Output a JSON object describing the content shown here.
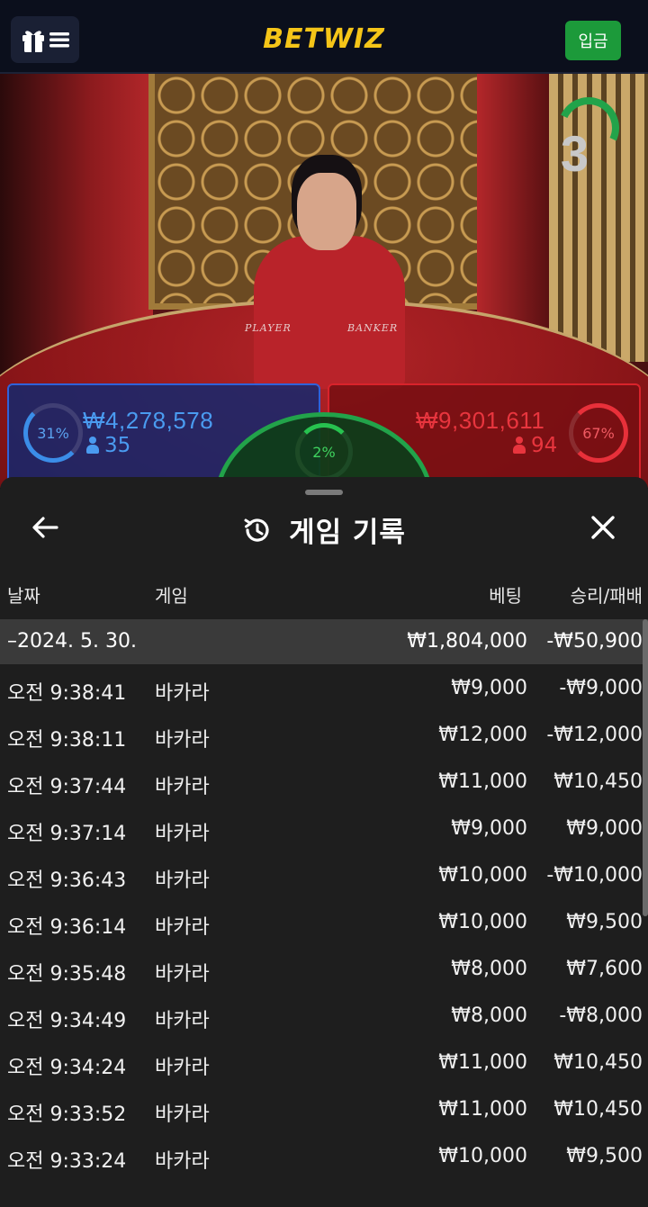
{
  "header": {
    "logo": "BETWIZ",
    "deposit_label": "입금",
    "menu_icon": "gift-menu-icon"
  },
  "live": {
    "countdown": "3",
    "table_labels": {
      "player": "PLAYER",
      "banker": "BANKER"
    },
    "player": {
      "percent": "31%",
      "amount": "₩4,278,578",
      "count": "35"
    },
    "banker": {
      "percent": "67%",
      "amount": "₩9,301,611",
      "count": "94"
    },
    "tie": {
      "percent": "2%"
    },
    "colors": {
      "player": "#2f62d9",
      "banker": "#d9232b",
      "tie": "#22a34a",
      "logo": "#f5c518"
    }
  },
  "history": {
    "title": "게임 기록",
    "title_icon": "history-clock-icon",
    "back_icon": "back-arrow-icon",
    "close_icon": "close-icon",
    "columns": {
      "date": "날짜",
      "game": "게임",
      "bet": "베팅",
      "result": "승리/패배"
    },
    "summary": {
      "date": "–2024. 5. 30.",
      "bet": "₩1,804,000",
      "result": "-₩50,900"
    },
    "rows": [
      {
        "time": "오전 9:38:41",
        "game": "바카라",
        "bet": "₩9,000",
        "result": "-₩9,000"
      },
      {
        "time": "오전 9:38:11",
        "game": "바카라",
        "bet": "₩12,000",
        "result": "-₩12,000"
      },
      {
        "time": "오전 9:37:44",
        "game": "바카라",
        "bet": "₩11,000",
        "result": "₩10,450"
      },
      {
        "time": "오전 9:37:14",
        "game": "바카라",
        "bet": "₩9,000",
        "result": "₩9,000"
      },
      {
        "time": "오전 9:36:43",
        "game": "바카라",
        "bet": "₩10,000",
        "result": "-₩10,000"
      },
      {
        "time": "오전 9:36:14",
        "game": "바카라",
        "bet": "₩10,000",
        "result": "₩9,500"
      },
      {
        "time": "오전 9:35:48",
        "game": "바카라",
        "bet": "₩8,000",
        "result": "₩7,600"
      },
      {
        "time": "오전 9:34:49",
        "game": "바카라",
        "bet": "₩8,000",
        "result": "-₩8,000"
      },
      {
        "time": "오전 9:34:24",
        "game": "바카라",
        "bet": "₩11,000",
        "result": "₩10,450"
      },
      {
        "time": "오전 9:33:52",
        "game": "바카라",
        "bet": "₩11,000",
        "result": "₩10,450"
      },
      {
        "time": "오전 9:33:24",
        "game": "바카라",
        "bet": "₩10,000",
        "result": "₩9,500"
      }
    ]
  }
}
